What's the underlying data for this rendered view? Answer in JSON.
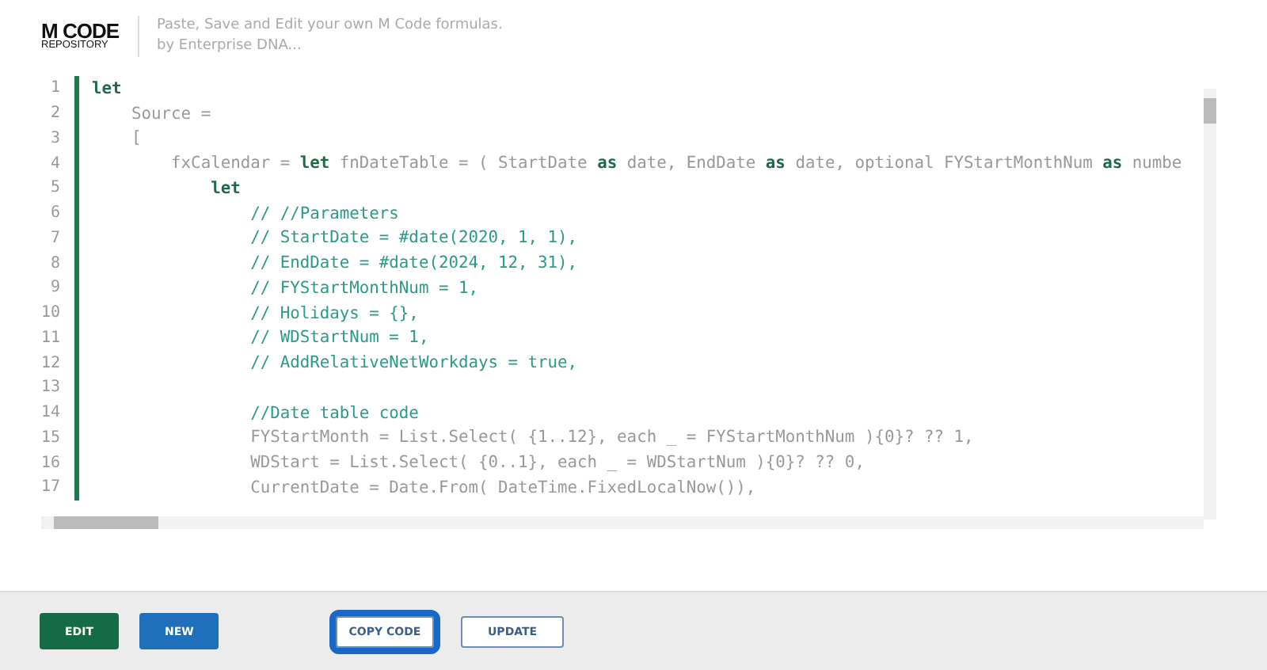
{
  "header": {
    "logo_title": "M CODE",
    "logo_subtitle": "REPOSITORY",
    "tagline": "Paste, Save and Edit your own M Code formulas.",
    "byline": "by Enterprise DNA..."
  },
  "editor": {
    "lines": [
      {
        "number": "1",
        "tokens": [
          {
            "kind": "keyword",
            "text": "let"
          }
        ]
      },
      {
        "number": "2",
        "tokens": [
          {
            "kind": "plain",
            "text": "    Source ="
          }
        ]
      },
      {
        "number": "3",
        "tokens": [
          {
            "kind": "plain",
            "text": "    ["
          }
        ]
      },
      {
        "number": "4",
        "tokens": [
          {
            "kind": "plain",
            "text": "        fxCalendar = "
          },
          {
            "kind": "keyword",
            "text": "let"
          },
          {
            "kind": "plain",
            "text": " fnDateTable = ( StartDate "
          },
          {
            "kind": "keyword",
            "text": "as"
          },
          {
            "kind": "plain",
            "text": " date, EndDate "
          },
          {
            "kind": "keyword",
            "text": "as"
          },
          {
            "kind": "plain",
            "text": " date, optional FYStartMonthNum "
          },
          {
            "kind": "keyword",
            "text": "as"
          },
          {
            "kind": "plain",
            "text": " numbe"
          }
        ]
      },
      {
        "number": "5",
        "tokens": [
          {
            "kind": "keyword",
            "text": "            let"
          }
        ]
      },
      {
        "number": "6",
        "tokens": [
          {
            "kind": "comment",
            "text": "                // //Parameters"
          }
        ]
      },
      {
        "number": "7",
        "tokens": [
          {
            "kind": "comment",
            "text": "                // StartDate = #date(2020, 1, 1),"
          }
        ]
      },
      {
        "number": "8",
        "tokens": [
          {
            "kind": "comment",
            "text": "                // EndDate = #date(2024, 12, 31),"
          }
        ]
      },
      {
        "number": "9",
        "tokens": [
          {
            "kind": "comment",
            "text": "                // FYStartMonthNum = 1,"
          }
        ]
      },
      {
        "number": "10",
        "tokens": [
          {
            "kind": "comment",
            "text": "                // Holidays = {},"
          }
        ]
      },
      {
        "number": "11",
        "tokens": [
          {
            "kind": "comment",
            "text": "                // WDStartNum = 1,"
          }
        ]
      },
      {
        "number": "12",
        "tokens": [
          {
            "kind": "comment",
            "text": "                // AddRelativeNetWorkdays = true,"
          }
        ]
      },
      {
        "number": "13"
      },
      {
        "number": "14",
        "tokens": [
          {
            "kind": "comment",
            "text": "                //Date table code"
          }
        ]
      },
      {
        "number": "15",
        "tokens": [
          {
            "kind": "plain",
            "text": "                FYStartMonth = List.Select( {1..12}, each _ = FYStartMonthNum ){0}? ?? 1,"
          }
        ]
      },
      {
        "number": "16",
        "tokens": [
          {
            "kind": "plain",
            "text": "                WDStart = List.Select( {0..1}, each _ = WDStartNum ){0}? ?? 0,"
          }
        ]
      },
      {
        "number": "17",
        "tokens": [
          {
            "kind": "plain",
            "text": "                CurrentDate = Date.From( DateTime.FixedLocalNow()),"
          }
        ]
      }
    ]
  },
  "buttons": [
    {
      "label": "EDIT",
      "kind": "green",
      "selected": false
    },
    {
      "label": "NEW",
      "kind": "blue",
      "selected": false
    },
    {
      "label": "COPY CODE",
      "kind": "outline",
      "selected": true
    },
    {
      "label": "UPDATE",
      "kind": "outline",
      "selected": false
    }
  ]
}
